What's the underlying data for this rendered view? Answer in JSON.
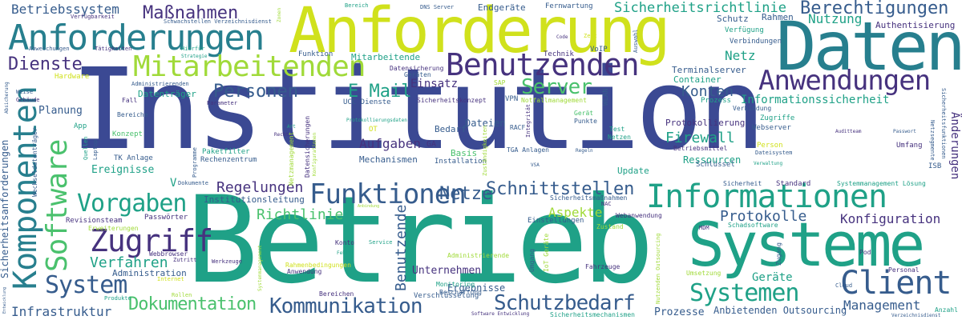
{
  "palette": {
    "navy": "#3b4993",
    "indigo": "#46327e",
    "blue": "#365c8d",
    "teal": "#277f8e",
    "green": "#1fa187",
    "lightgreen": "#4ac16d",
    "yellowgreen": "#a0da39",
    "yellow": "#d0e11c"
  },
  "words": [
    {
      "text": "Institution",
      "color": "navy"
    },
    {
      "text": "Betrieb",
      "color": "green"
    },
    {
      "text": "Anforderung",
      "color": "yellow"
    },
    {
      "text": "Daten",
      "color": "teal"
    },
    {
      "text": "Systeme",
      "color": "green"
    },
    {
      "text": "Anforderungen",
      "color": "teal"
    },
    {
      "text": "Benutzenden",
      "color": "indigo"
    },
    {
      "text": "Mitarbeitenden",
      "color": "yellowgreen"
    },
    {
      "text": "Informationen",
      "color": "green"
    },
    {
      "text": "Anwendungen",
      "color": "indigo"
    },
    {
      "text": "Komponenten",
      "color": "teal"
    },
    {
      "text": "Software",
      "color": "lightgreen"
    },
    {
      "text": "Funktionen",
      "color": "blue"
    },
    {
      "text": "Client",
      "color": "blue"
    },
    {
      "text": "Systemen",
      "color": "green"
    },
    {
      "text": "Zugriff",
      "color": "indigo"
    },
    {
      "text": "Vorgaben",
      "color": "green"
    },
    {
      "text": "System",
      "color": "blue"
    },
    {
      "text": "Kommunikation",
      "color": "blue"
    },
    {
      "text": "Schutzbedarf",
      "color": "blue"
    },
    {
      "text": "Dokumentation",
      "color": "lightgreen"
    },
    {
      "text": "Dienste",
      "color": "indigo"
    },
    {
      "text": "Personen",
      "color": "blue"
    },
    {
      "text": "Server",
      "color": "lightgreen"
    },
    {
      "text": "Schnittstellen",
      "color": "blue"
    },
    {
      "text": "Berechtigungen",
      "color": "blue"
    },
    {
      "text": "Maßnahmen",
      "color": "indigo"
    },
    {
      "text": "Betriebssystem",
      "color": "blue"
    },
    {
      "text": "Sicherheitsrichtlinie",
      "color": "green"
    },
    {
      "text": "Netze",
      "color": "blue"
    },
    {
      "text": "Regelungen",
      "color": "indigo"
    },
    {
      "text": "Protokolle",
      "color": "blue"
    },
    {
      "text": "Konfiguration",
      "color": "indigo"
    },
    {
      "text": "Richtlinie",
      "color": "lightgreen"
    },
    {
      "text": "Management",
      "color": "blue"
    },
    {
      "text": "Aspekte",
      "color": "yellowgreen"
    },
    {
      "text": "Firewall",
      "color": "green"
    },
    {
      "text": "Konten",
      "color": "blue"
    },
    {
      "text": "Informationssicherheit",
      "color": "green"
    },
    {
      "text": "Verfahren",
      "color": "green"
    },
    {
      "text": "Infrastruktur",
      "color": "blue"
    },
    {
      "text": "Nutzung",
      "color": "green"
    },
    {
      "text": "Netz",
      "color": "green"
    },
    {
      "text": "E Mail",
      "color": "green"
    },
    {
      "text": "Aufgaben",
      "color": "indigo"
    },
    {
      "text": "Benutzende",
      "color": "blue"
    },
    {
      "text": "Prozesse",
      "color": "blue"
    },
    {
      "text": "Geräte",
      "color": "green"
    },
    {
      "text": "Ereignisse",
      "color": "green"
    },
    {
      "text": "Änderungen",
      "color": "indigo"
    },
    {
      "text": "Sicherheitsanforderungen",
      "color": "blue"
    },
    {
      "text": "Anbietenden Outsourcing",
      "color": "blue"
    },
    {
      "text": "Unternehmen",
      "color": "indigo"
    },
    {
      "text": "Ergebnisse",
      "color": "blue"
    },
    {
      "text": "Protokollierung",
      "color": "indigo"
    },
    {
      "text": "Ressourcen",
      "color": "green"
    },
    {
      "text": "Terminalserver",
      "color": "blue"
    },
    {
      "text": "Container",
      "color": "green"
    },
    {
      "text": "Update",
      "color": "green"
    },
    {
      "text": "Institutionsleitung",
      "color": "blue"
    },
    {
      "text": "Authentisierung",
      "color": "indigo"
    },
    {
      "text": "Dateien",
      "color": "blue"
    },
    {
      "text": "Planung",
      "color": "blue"
    },
    {
      "text": "Datenträger",
      "color": "green"
    },
    {
      "text": "Einsatz",
      "color": "indigo"
    },
    {
      "text": "Bedarf",
      "color": "blue"
    },
    {
      "text": "Mechanismen",
      "color": "blue"
    },
    {
      "text": "Installation",
      "color": "blue"
    },
    {
      "text": "Einstellungen",
      "color": "blue"
    },
    {
      "text": "Revisionsteam",
      "color": "indigo"
    },
    {
      "text": "Passwörter",
      "color": "indigo"
    },
    {
      "text": "Administration",
      "color": "blue"
    },
    {
      "text": "Verschlüsselung",
      "color": "blue"
    },
    {
      "text": "Rechenzentrum",
      "color": "blue"
    },
    {
      "text": "Paketfilter",
      "color": "green"
    },
    {
      "text": "TK Anlage",
      "color": "blue"
    },
    {
      "text": "Konzept",
      "color": "lightgreen"
    },
    {
      "text": "Basis",
      "color": "lightgreen"
    },
    {
      "text": "Schutz",
      "color": "blue"
    },
    {
      "text": "Rahmen",
      "color": "blue"
    },
    {
      "text": "Verbindungen",
      "color": "blue"
    },
    {
      "text": "Verfügung",
      "color": "green"
    },
    {
      "text": "Endgeräte",
      "color": "blue"
    },
    {
      "text": "Fernwartung",
      "color": "blue"
    },
    {
      "text": "Technik",
      "color": "indigo"
    },
    {
      "text": "VoIP",
      "color": "blue"
    },
    {
      "text": "Funktion",
      "color": "blue"
    },
    {
      "text": "Mitarbeitende",
      "color": "green"
    },
    {
      "text": "Datensicherung",
      "color": "indigo"
    },
    {
      "text": "Geräten",
      "color": "blue"
    },
    {
      "text": "Sicherheitskonzept",
      "color": "indigo"
    },
    {
      "text": "UCC Dienste",
      "color": "blue"
    },
    {
      "text": "VPN",
      "color": "blue"
    },
    {
      "text": "SAP",
      "color": "yellowgreen"
    },
    {
      "text": "Notfallmanagement",
      "color": "yellowgreen"
    },
    {
      "text": "Prozess",
      "color": "green"
    },
    {
      "text": "Verbindung",
      "color": "blue"
    },
    {
      "text": "Zugriffe",
      "color": "green"
    },
    {
      "text": "Webserver",
      "color": "blue"
    },
    {
      "text": "Person",
      "color": "yellow"
    },
    {
      "text": "Dateisystem",
      "color": "blue"
    },
    {
      "text": "Verwaltung",
      "color": "green"
    },
    {
      "text": "Schlüssel",
      "color": "blue"
    },
    {
      "text": "Umfang",
      "color": "indigo"
    },
    {
      "text": "Auditteam",
      "color": "indigo"
    },
    {
      "text": "Passwort",
      "color": "blue"
    },
    {
      "text": "ISB",
      "color": "blue"
    },
    {
      "text": "Standard",
      "color": "indigo"
    },
    {
      "text": "Sicherheit",
      "color": "blue"
    },
    {
      "text": "Systemmanagement Lösung",
      "color": "green"
    },
    {
      "text": "Schadsoftware",
      "color": "green"
    },
    {
      "text": "Webanwendung",
      "color": "indigo"
    },
    {
      "text": "Zustand",
      "color": "yellowgreen"
    },
    {
      "text": "Personal",
      "color": "indigo"
    },
    {
      "text": "Pod",
      "color": "indigo"
    },
    {
      "text": "Cloud",
      "color": "blue"
    },
    {
      "text": "Anzahl",
      "color": "green"
    },
    {
      "text": "Verzeichnisdienst",
      "color": "blue"
    },
    {
      "text": "Umsetzung",
      "color": "yellowgreen"
    },
    {
      "text": "Fahrzeuge",
      "color": "indigo"
    },
    {
      "text": "Umgang",
      "color": "blue"
    },
    {
      "text": "Monitoring",
      "color": "green"
    },
    {
      "text": "Beschaffung",
      "color": "blue"
    },
    {
      "text": "Software Entwicklung",
      "color": "indigo"
    },
    {
      "text": "Sicherheitsmechanismen",
      "color": "green"
    },
    {
      "text": "Sicherheitsmaßnahmen",
      "color": "blue"
    },
    {
      "text": "NAC",
      "color": "indigo"
    },
    {
      "text": "TGA Anlagen",
      "color": "blue"
    },
    {
      "text": "RACF",
      "color": "blue"
    },
    {
      "text": "Regeln",
      "color": "blue"
    },
    {
      "text": "VSA",
      "color": "blue"
    },
    {
      "text": "Punkte",
      "color": "blue"
    },
    {
      "text": "Netzen",
      "color": "green"
    },
    {
      "text": "Test",
      "color": "green"
    },
    {
      "text": "Betriebsmittel",
      "color": "indigo"
    },
    {
      "text": "Gerät",
      "color": "lightgreen"
    },
    {
      "text": "Administrierende",
      "color": "yellowgreen"
    },
    {
      "text": "Dokumente",
      "color": "blue"
    },
    {
      "text": "Programme",
      "color": "blue"
    },
    {
      "text": "Rechte",
      "color": "indigo"
    },
    {
      "text": "Art",
      "color": "green"
    },
    {
      "text": "OT",
      "color": "yellow"
    },
    {
      "text": "GA",
      "color": "indigo"
    },
    {
      "text": "Protokollierungsdaten",
      "color": "green"
    },
    {
      "text": "Laptop",
      "color": "blue"
    },
    {
      "text": "Quellen",
      "color": "green"
    },
    {
      "text": "Bereiche",
      "color": "blue"
    },
    {
      "text": "App",
      "color": "green"
    },
    {
      "text": "Fall",
      "color": "indigo"
    },
    {
      "text": "Parameter",
      "color": "indigo"
    },
    {
      "text": "Administrierenden",
      "color": "blue"
    },
    {
      "text": "Hardware",
      "color": "yellow"
    },
    {
      "text": "Strategie",
      "color": "green"
    },
    {
      "text": "Hierfür",
      "color": "green"
    },
    {
      "text": "Tätigkeiten",
      "color": "indigo"
    },
    {
      "text": "Abweichungen",
      "color": "blue"
    },
    {
      "text": "Verfügbarkeit",
      "color": "indigo"
    },
    {
      "text": "Schwachstellen Verzeichnisdienst",
      "color": "blue"
    },
    {
      "text": "Bereich",
      "color": "green"
    },
    {
      "text": "DNS Server",
      "color": "blue"
    },
    {
      "text": "Zonen",
      "color": "yellowgreen"
    },
    {
      "text": "Code",
      "color": "indigo"
    },
    {
      "text": "Zeit",
      "color": "yellow"
    },
    {
      "text": "Auswahl",
      "color": "blue"
    },
    {
      "text": "Weise",
      "color": "blue"
    },
    {
      "text": "Gebäude",
      "color": "indigo"
    },
    {
      "text": "Absicherung",
      "color": "blue"
    },
    {
      "text": "Wechseldatenträger",
      "color": "blue"
    },
    {
      "text": "Erweiterungen",
      "color": "yellowgreen"
    },
    {
      "text": "Webbrowser",
      "color": "indigo"
    },
    {
      "text": "Zutritt",
      "color": "indigo"
    },
    {
      "text": "Werkzeuge",
      "color": "indigo"
    },
    {
      "text": "Konto",
      "color": "indigo"
    },
    {
      "text": "Service",
      "color": "green"
    },
    {
      "text": "Fehler",
      "color": "green"
    },
    {
      "text": "Internet",
      "color": "yellow"
    },
    {
      "text": "Rahmenbedingungen",
      "color": "yellow"
    },
    {
      "text": "Anwendung",
      "color": "indigo"
    },
    {
      "text": "Produkte",
      "color": "green"
    },
    {
      "text": "Rollen",
      "color": "yellowgreen"
    },
    {
      "text": "Bereichen",
      "color": "indigo"
    },
    {
      "text": "Entwicklung",
      "color": "blue"
    },
    {
      "text": "Systemmanagement",
      "color": "yellowgreen"
    },
    {
      "text": "Netzmanagement",
      "color": "yellowgreen"
    },
    {
      "text": "Datensicherungen",
      "color": "indigo"
    },
    {
      "text": "Konfigurationen",
      "color": "yellowgreen"
    },
    {
      "text": "Zuständigkeiten",
      "color": "yellowgreen"
    },
    {
      "text": "Integrität",
      "color": "indigo"
    },
    {
      "text": "IoT Geräte",
      "color": "yellowgreen"
    },
    {
      "text": "Anbindung",
      "color": "yellowgreen"
    },
    {
      "text": "Zugang",
      "color": "blue"
    },
    {
      "text": "MDM",
      "color": "indigo"
    },
    {
      "text": "Nutzenden Outsourcing",
      "color": "yellowgreen"
    },
    {
      "text": "Netzsegmente",
      "color": "blue"
    },
    {
      "text": "Sicherheitsfunktionen",
      "color": "blue"
    },
    {
      "text": "WLAN",
      "color": "blue"
    },
    {
      "text": "V",
      "color": "green"
    }
  ]
}
